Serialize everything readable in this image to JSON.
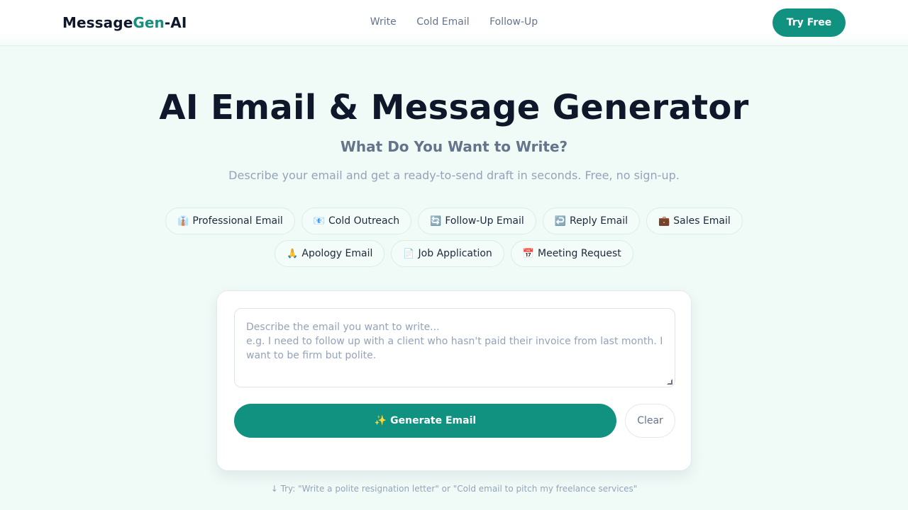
{
  "header": {
    "logo": {
      "part1": "Message",
      "part2": "Gen",
      "part3": "-AI"
    },
    "nav": [
      "Write",
      "Cold Email",
      "Follow-Up"
    ],
    "cta": "Try Free"
  },
  "hero": {
    "title": "AI Email & Message Generator",
    "subtitle": "What Do You Want to Write?",
    "description": "Describe your email and get a ready-to-send draft in seconds. Free, no sign-up."
  },
  "chips": [
    {
      "icon": "👔",
      "icon_name": "necktie-icon",
      "label": "Professional Email"
    },
    {
      "icon": "📧",
      "icon_name": "email-icon",
      "label": "Cold Outreach"
    },
    {
      "icon": "🔄",
      "icon_name": "refresh-icon",
      "label": "Follow-Up Email"
    },
    {
      "icon": "↩️",
      "icon_name": "reply-arrow-icon",
      "label": "Reply Email"
    },
    {
      "icon": "💼",
      "icon_name": "briefcase-icon",
      "label": "Sales Email"
    },
    {
      "icon": "🙏",
      "icon_name": "folded-hands-icon",
      "label": "Apology Email"
    },
    {
      "icon": "📄",
      "icon_name": "document-icon",
      "label": "Job Application"
    },
    {
      "icon": "📅",
      "icon_name": "calendar-icon",
      "label": "Meeting Request"
    }
  ],
  "composer": {
    "placeholder": "Describe the email you want to write...\ne.g. I need to follow up with a client who hasn't paid their invoice from last month. I want to be firm but polite.",
    "value": "",
    "generate_label": "✨ Generate Email",
    "clear_label": "Clear"
  },
  "hint": "↓ Try: \"Write a polite resignation letter\" or \"Cold email to pitch my freelance services\"",
  "colors": {
    "accent": "#11917f",
    "background": "#f0fbf8",
    "text": "#0f172a",
    "muted": "#64748b"
  }
}
